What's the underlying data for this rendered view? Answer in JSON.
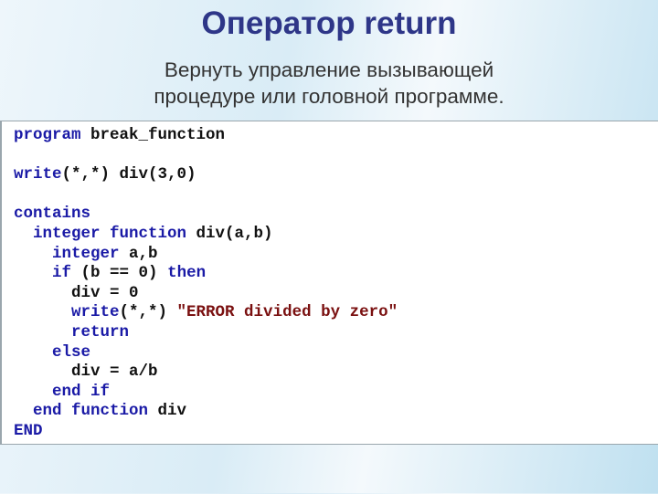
{
  "header": {
    "title": "Оператор return",
    "subtitle_line1": "Вернуть управление вызывающей",
    "subtitle_line2": "процедуре  или головной программе."
  },
  "code": [
    [
      [
        "kw",
        "program"
      ],
      [
        "p",
        " break_function"
      ]
    ],
    [],
    [
      [
        "kw",
        "write"
      ],
      [
        "p",
        "(*,*) div(3,0)"
      ]
    ],
    [],
    [
      [
        "kw",
        "contains"
      ]
    ],
    [
      [
        "p",
        "  "
      ],
      [
        "kw",
        "integer function"
      ],
      [
        "p",
        " div(a,b)"
      ]
    ],
    [
      [
        "p",
        "    "
      ],
      [
        "kw",
        "integer"
      ],
      [
        "p",
        " a,b"
      ]
    ],
    [
      [
        "p",
        "    "
      ],
      [
        "kw",
        "if"
      ],
      [
        "p",
        " (b == 0) "
      ],
      [
        "kw",
        "then"
      ]
    ],
    [
      [
        "p",
        "      div = 0"
      ]
    ],
    [
      [
        "p",
        "      "
      ],
      [
        "kw",
        "write"
      ],
      [
        "p",
        "(*,*) "
      ],
      [
        "str",
        "\"ERROR divided by zero\""
      ]
    ],
    [
      [
        "p",
        "      "
      ],
      [
        "kw",
        "return"
      ]
    ],
    [
      [
        "p",
        "    "
      ],
      [
        "kw",
        "else"
      ]
    ],
    [
      [
        "p",
        "      div = a/b"
      ]
    ],
    [
      [
        "p",
        "    "
      ],
      [
        "kw",
        "end if"
      ]
    ],
    [
      [
        "p",
        "  "
      ],
      [
        "kw",
        "end function"
      ],
      [
        "p",
        " div"
      ]
    ],
    [
      [
        "kw",
        "END"
      ]
    ]
  ],
  "colors": {
    "title": "#2e3688",
    "keyword": "#1a1aa6",
    "string": "#7a1010"
  }
}
